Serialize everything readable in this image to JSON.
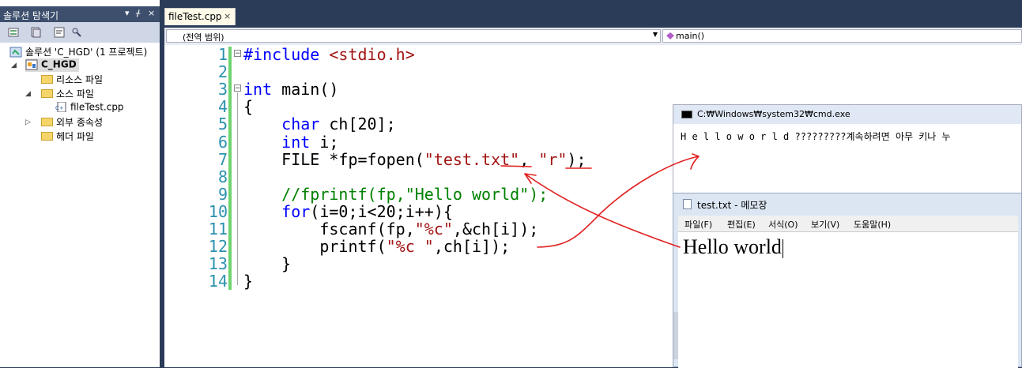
{
  "solution_explorer": {
    "title": "솔루션 탐색기",
    "pin": "▾ ᚋ ×",
    "items": [
      {
        "label": "솔루션 'C_HGD' (1 프로젝트)"
      },
      {
        "label": "C_HGD"
      },
      {
        "label": "리소스 파일"
      },
      {
        "label": "소스 파일"
      },
      {
        "label": "fileTest.cpp"
      },
      {
        "label": "외부 종속성"
      },
      {
        "label": "헤더 파일"
      }
    ]
  },
  "editor": {
    "tab_label": "fileTest.cpp",
    "tab_close": "×",
    "scope_combo": "(전역 범위)",
    "function_combo": "main()",
    "line_numbers": [
      "1",
      "2",
      "3",
      "4",
      "5",
      "6",
      "7",
      "8",
      "9",
      "10",
      "11",
      "12",
      "13",
      "14"
    ],
    "code": [
      [
        {
          "c": "kw",
          "t": "#include "
        },
        {
          "c": "str",
          "t": "<stdio.h>"
        }
      ],
      [],
      [
        {
          "c": "kw",
          "t": "int"
        },
        {
          "c": "",
          "t": " main()"
        }
      ],
      [
        {
          "c": "",
          "t": "{"
        }
      ],
      [
        {
          "c": "",
          "t": "    "
        },
        {
          "c": "kw",
          "t": "char"
        },
        {
          "c": "",
          "t": " ch[20];"
        }
      ],
      [
        {
          "c": "",
          "t": "    "
        },
        {
          "c": "kw",
          "t": "int"
        },
        {
          "c": "",
          "t": " i;"
        }
      ],
      [
        {
          "c": "",
          "t": "    FILE *fp=fopen("
        },
        {
          "c": "str",
          "t": "\"test.txt\""
        },
        {
          "c": "",
          "t": ", "
        },
        {
          "c": "str",
          "t": "\"r\""
        },
        {
          "c": "",
          "t": ");"
        }
      ],
      [],
      [
        {
          "c": "",
          "t": "    "
        },
        {
          "c": "cmt",
          "t": "//fprintf(fp,\"Hello world\");"
        }
      ],
      [
        {
          "c": "",
          "t": "    "
        },
        {
          "c": "kw",
          "t": "for"
        },
        {
          "c": "",
          "t": "(i=0;i<20;i++){"
        }
      ],
      [
        {
          "c": "",
          "t": "        fscanf(fp,"
        },
        {
          "c": "str",
          "t": "\"%c\""
        },
        {
          "c": "",
          "t": ",&ch[i]);"
        }
      ],
      [
        {
          "c": "",
          "t": "        printf("
        },
        {
          "c": "str",
          "t": "\"%c \""
        },
        {
          "c": "",
          "t": ",ch[i]);"
        }
      ],
      [
        {
          "c": "",
          "t": "    }"
        }
      ],
      [
        {
          "c": "",
          "t": "}"
        }
      ]
    ]
  },
  "cmd_window": {
    "title": "C:₩Windows₩system32₩cmd.exe",
    "output": "H e l l o   w o r l d ?????????계속하려면 아무 키나 누"
  },
  "notepad": {
    "title": "test.txt - 메모장",
    "menu": [
      "파일(F)",
      "편집(E)",
      "서식(O)",
      "보기(V)",
      "도움말(H)"
    ],
    "content": "Hello world"
  },
  "colors": {
    "keyword": "#0000ff",
    "string": "#a31515",
    "comment": "#008000",
    "line_number": "#2b91af",
    "annotation": "#e0201f"
  }
}
